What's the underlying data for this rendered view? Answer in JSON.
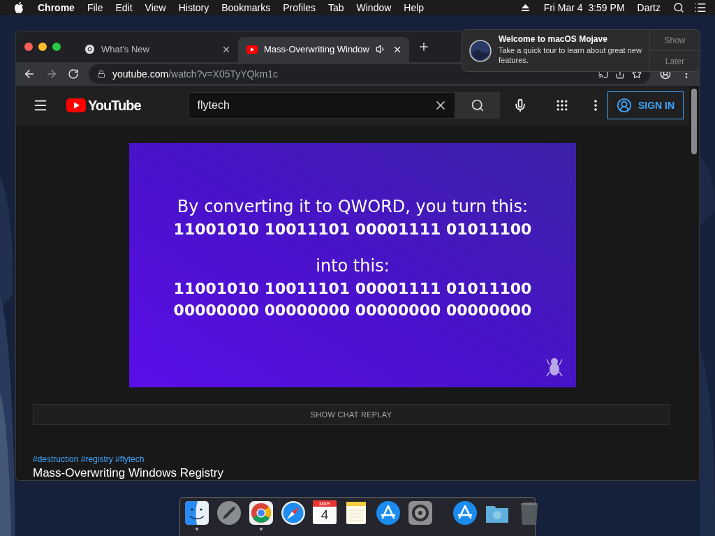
{
  "menubar": {
    "app": "Chrome",
    "menus": [
      "File",
      "Edit",
      "View",
      "History",
      "Bookmarks",
      "Profiles",
      "Tab",
      "Window",
      "Help"
    ],
    "date_time": "Fri Mar 4  3:59 PM",
    "user": "Dartz"
  },
  "browser": {
    "tabs": [
      {
        "title": "What's New",
        "selected": false,
        "kind": "chrome",
        "audio": false
      },
      {
        "title": "Mass-Overwriting Window",
        "selected": true,
        "kind": "youtube",
        "audio": true
      }
    ],
    "url_host": "youtube.com",
    "url_path": "/watch?v=X05TyYQkm1c"
  },
  "youtube": {
    "logo": "YouTube",
    "search": "flytech",
    "sign_in": "SIGN IN"
  },
  "slide": {
    "paragraphs": [
      {
        "caption": "By converting it to QWORD, you turn this:",
        "binary": [
          "11001010 10011101 00001111 01011100"
        ]
      },
      {
        "caption": "into this:",
        "binary": [
          "11001010 10011101 00001111 01011100",
          "00000000 00000000 00000000 00000000"
        ]
      }
    ]
  },
  "chat_replay": "SHOW CHAT REPLAY",
  "hashtags": "#destruction #registry #flytech",
  "video_title": "Mass-Overwriting Windows Registry",
  "notification": {
    "title": "Welcome to macOS Mojave",
    "body": "Take a quick tour to learn about great new features.",
    "actions": [
      "Show",
      "Later"
    ]
  },
  "dock": {
    "items": [
      {
        "kind": "finder",
        "running": true
      },
      {
        "kind": "launchpad",
        "running": false
      },
      {
        "kind": "chrome",
        "running": true
      },
      {
        "kind": "safari",
        "running": false
      },
      {
        "kind": "calendar",
        "running": false,
        "month": "MAR",
        "day": "4"
      },
      {
        "kind": "notes",
        "running": false
      },
      {
        "kind": "appstore",
        "running": false
      },
      {
        "kind": "preferences",
        "running": false
      },
      {
        "kind": "separator"
      },
      {
        "kind": "appstore",
        "running": false
      },
      {
        "kind": "folder",
        "running": false
      },
      {
        "kind": "trash",
        "running": false
      }
    ]
  }
}
